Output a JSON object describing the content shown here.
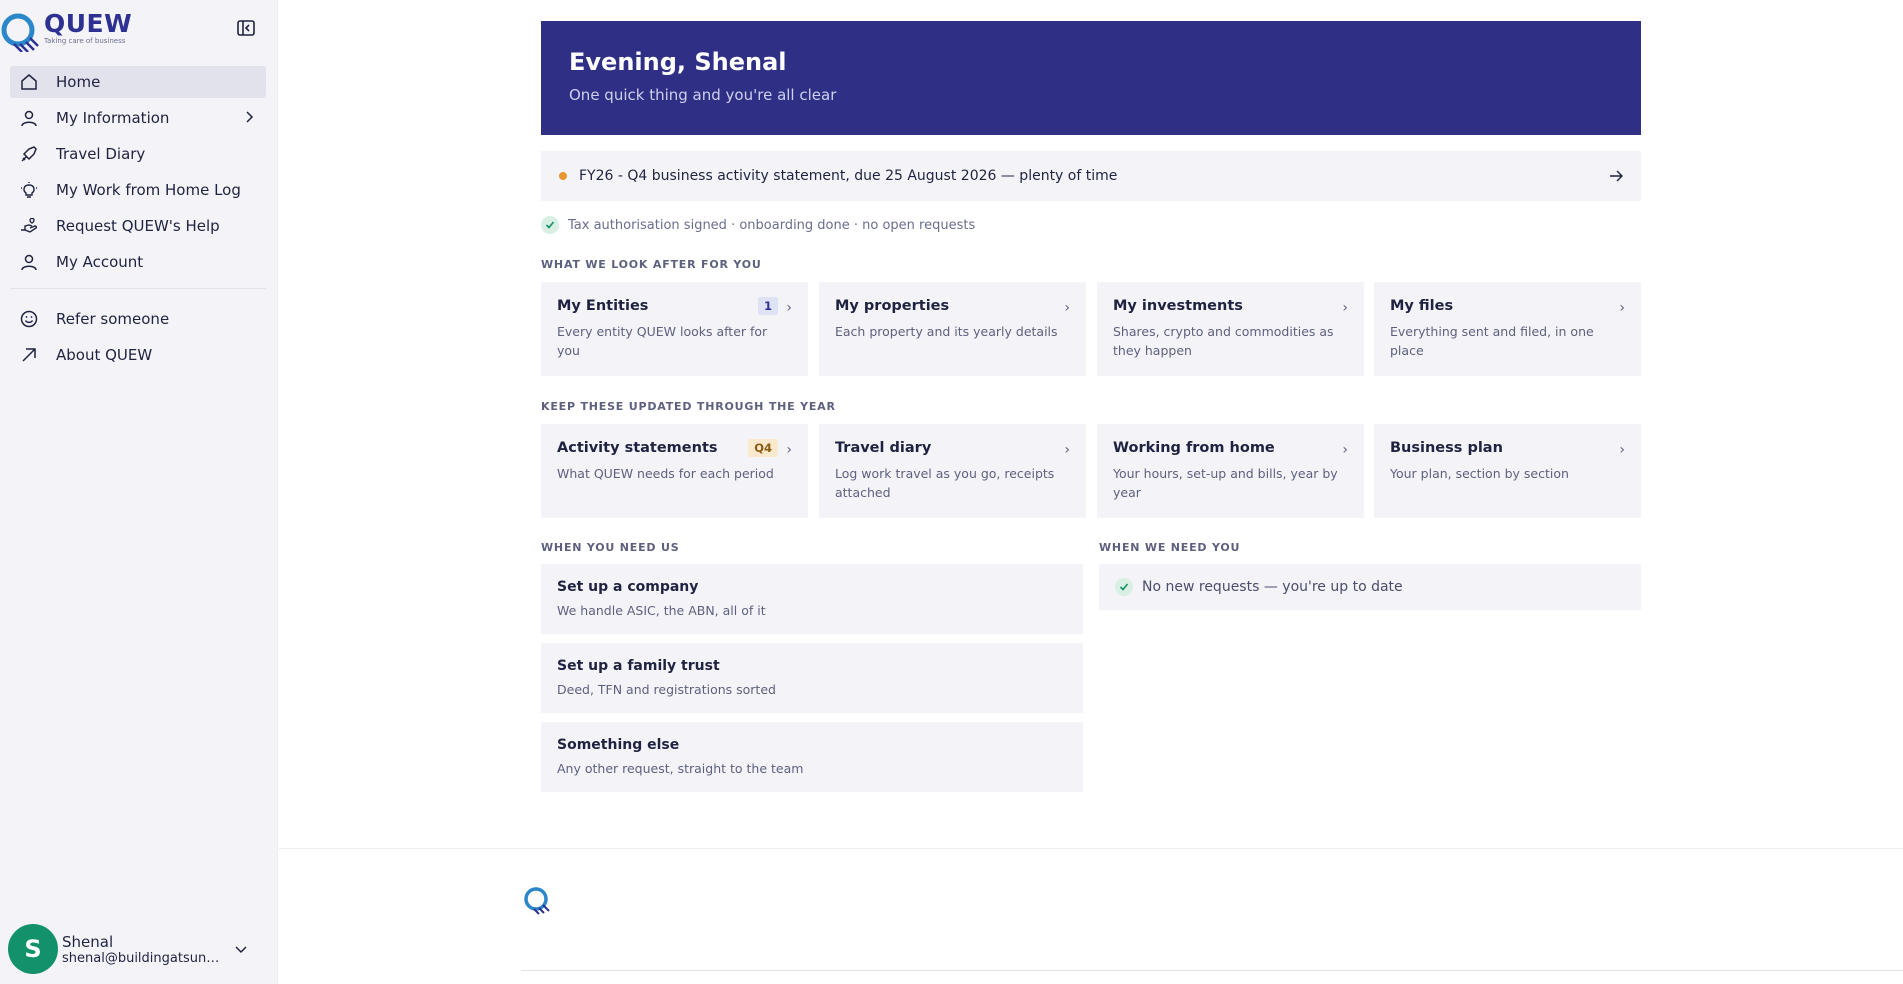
{
  "brand": {
    "name": "QUEW",
    "tagline": "Taking care of business",
    "primary": "#2e3192",
    "accent": "#12916b"
  },
  "sidebar": {
    "items": [
      {
        "label": "Home",
        "icon": "home-icon",
        "active": true
      },
      {
        "label": "My Information",
        "icon": "user-icon",
        "has_submenu": true
      },
      {
        "label": "Travel Diary",
        "icon": "plane-icon"
      },
      {
        "label": "My Work from Home Log",
        "icon": "lightbulb-icon"
      },
      {
        "label": "Request QUEW's Help",
        "icon": "hand-help-icon"
      },
      {
        "label": "My Account",
        "icon": "user-icon"
      }
    ],
    "secondary": [
      {
        "label": "Refer someone",
        "icon": "smile-icon"
      },
      {
        "label": "About QUEW",
        "icon": "arrow-up-right-icon"
      }
    ]
  },
  "profile": {
    "initial": "S",
    "name": "Shenal",
    "email": "shenal@buildingatsunset.com"
  },
  "hero": {
    "title": "Evening, Shenal",
    "subtitle": "One quick thing and you're all clear"
  },
  "notice": {
    "text": "FY26 - Q4 business activity statement, due 25 August 2026 — plenty of time",
    "dot_color": "#e8962e"
  },
  "status": {
    "text": "Tax authorisation signed · onboarding done · no open requests"
  },
  "sections": {
    "look_after": {
      "label": "WHAT WE LOOK AFTER FOR YOU",
      "cards": [
        {
          "title": "My Entities",
          "desc": "Every entity QUEW looks after for you",
          "badge": "1"
        },
        {
          "title": "My properties",
          "desc": "Each property and its yearly details"
        },
        {
          "title": "My investments",
          "desc": "Shares, crypto and commodities as they happen"
        },
        {
          "title": "My files",
          "desc": "Everything sent and filed, in one place"
        }
      ]
    },
    "keep_updated": {
      "label": "KEEP THESE UPDATED THROUGH THE YEAR",
      "cards": [
        {
          "title": "Activity statements",
          "desc": "What QUEW needs for each period",
          "badge": "Q4"
        },
        {
          "title": "Travel diary",
          "desc": "Log work travel as you go, receipts attached"
        },
        {
          "title": "Working from home",
          "desc": "Your hours, set-up and bills, year by year"
        },
        {
          "title": "Business plan",
          "desc": "Your plan, section by section"
        }
      ]
    },
    "need_us": {
      "label": "WHEN YOU NEED US",
      "items": [
        {
          "title": "Set up a company",
          "desc": "We handle ASIC, the ABN, all of it"
        },
        {
          "title": "Set up a family trust",
          "desc": "Deed, TFN and registrations sorted"
        },
        {
          "title": "Something else",
          "desc": "Any other request, straight to the team"
        }
      ]
    },
    "need_you": {
      "label": "WHEN WE NEED YOU",
      "text": "No new requests — you're up to date"
    }
  },
  "chevron": "›"
}
